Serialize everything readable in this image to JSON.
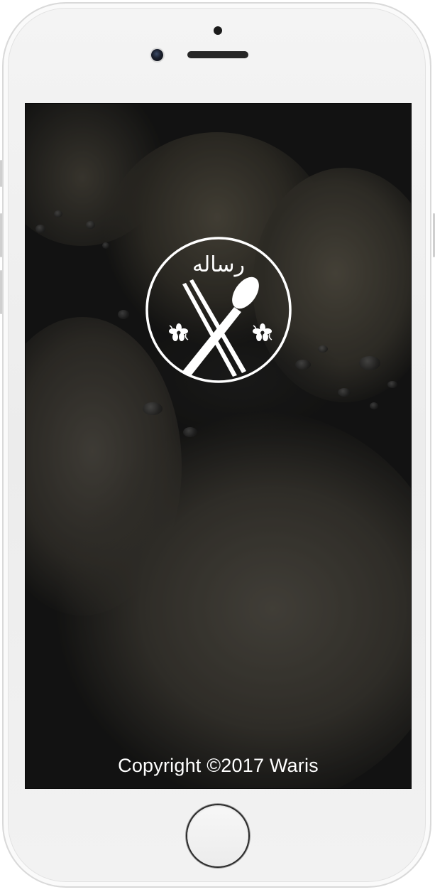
{
  "app": {
    "logo_label": "ﺭﺳﺎﻟﻪ",
    "copyright": "Copyright ©2017 Waris"
  },
  "icons": {
    "logo": "spoon-and-chopsticks-emblem-icon",
    "left_ornament": "flower-ornament-icon",
    "right_ornament": "flower-ornament-icon"
  },
  "colors": {
    "screen_background": "#1a1a19",
    "logo_stroke": "#ffffff",
    "copyright_text": "#ffffff",
    "device_frame": "#f0f0f0"
  }
}
